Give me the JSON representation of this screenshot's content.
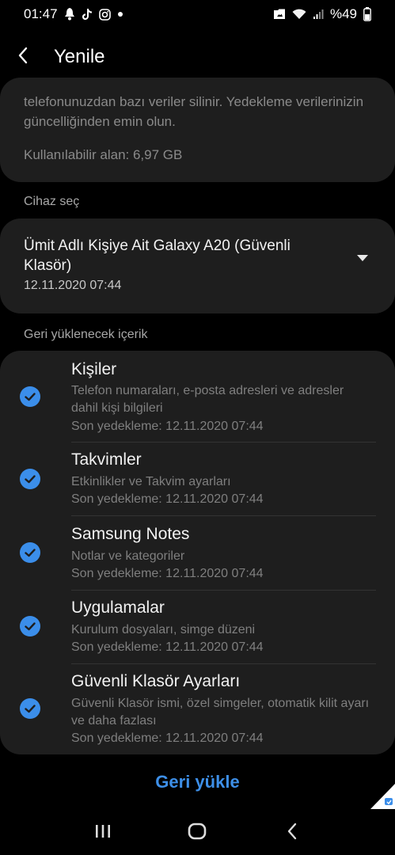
{
  "status_bar": {
    "time": "01:47",
    "battery": "%49",
    "icons_left": [
      "bell-icon",
      "tiktok-icon",
      "instagram-icon",
      "dot-icon"
    ],
    "icons_right": [
      "image-icon",
      "wifi-icon",
      "signal-icon",
      "battery-icon"
    ]
  },
  "app_bar": {
    "title": "Yenile"
  },
  "info": {
    "text": "telefonunuzdan bazı veriler silinir. Yedekleme verilerinizin güncelliğinden emin olun.",
    "available_space": "Kullanılabilir alan: 6,97 GB"
  },
  "device_section": {
    "label": "Cihaz seç",
    "device_name": "Ümit Adlı Kişiye Ait Galaxy A20 (Güvenli Klasör)",
    "device_date": "12.11.2020 07:44"
  },
  "content_section": {
    "label": "Geri yüklenecek içerik",
    "items": [
      {
        "title": "Kişiler",
        "desc": "Telefon numaraları, e-posta adresleri ve adresler dahil kişi bilgileri",
        "backup": "Son yedekleme: 12.11.2020 07:44",
        "checked": true
      },
      {
        "title": "Takvimler",
        "desc": "Etkinlikler ve Takvim ayarları",
        "backup": "Son yedekleme: 12.11.2020 07:44",
        "checked": true
      },
      {
        "title": "Samsung Notes",
        "desc": "Notlar ve kategoriler",
        "backup": "Son yedekleme: 12.11.2020 07:44",
        "checked": true
      },
      {
        "title": "Uygulamalar",
        "desc": "Kurulum dosyaları, simge düzeni",
        "backup": "Son yedekleme: 12.11.2020 07:44",
        "checked": true
      },
      {
        "title": "Güvenli Klasör Ayarları",
        "desc": "Güvenli Klasör ismi, özel simgeler, otomatik kilit ayarı ve daha fazlası",
        "backup": "Son yedekleme: 12.11.2020 07:44",
        "checked": true
      }
    ]
  },
  "restore_button": {
    "label": "Geri yükle"
  },
  "colors": {
    "background": "#000000",
    "card": "#1e1e1e",
    "accent": "#3b8eea",
    "secondary_text": "#7f7f7f"
  }
}
